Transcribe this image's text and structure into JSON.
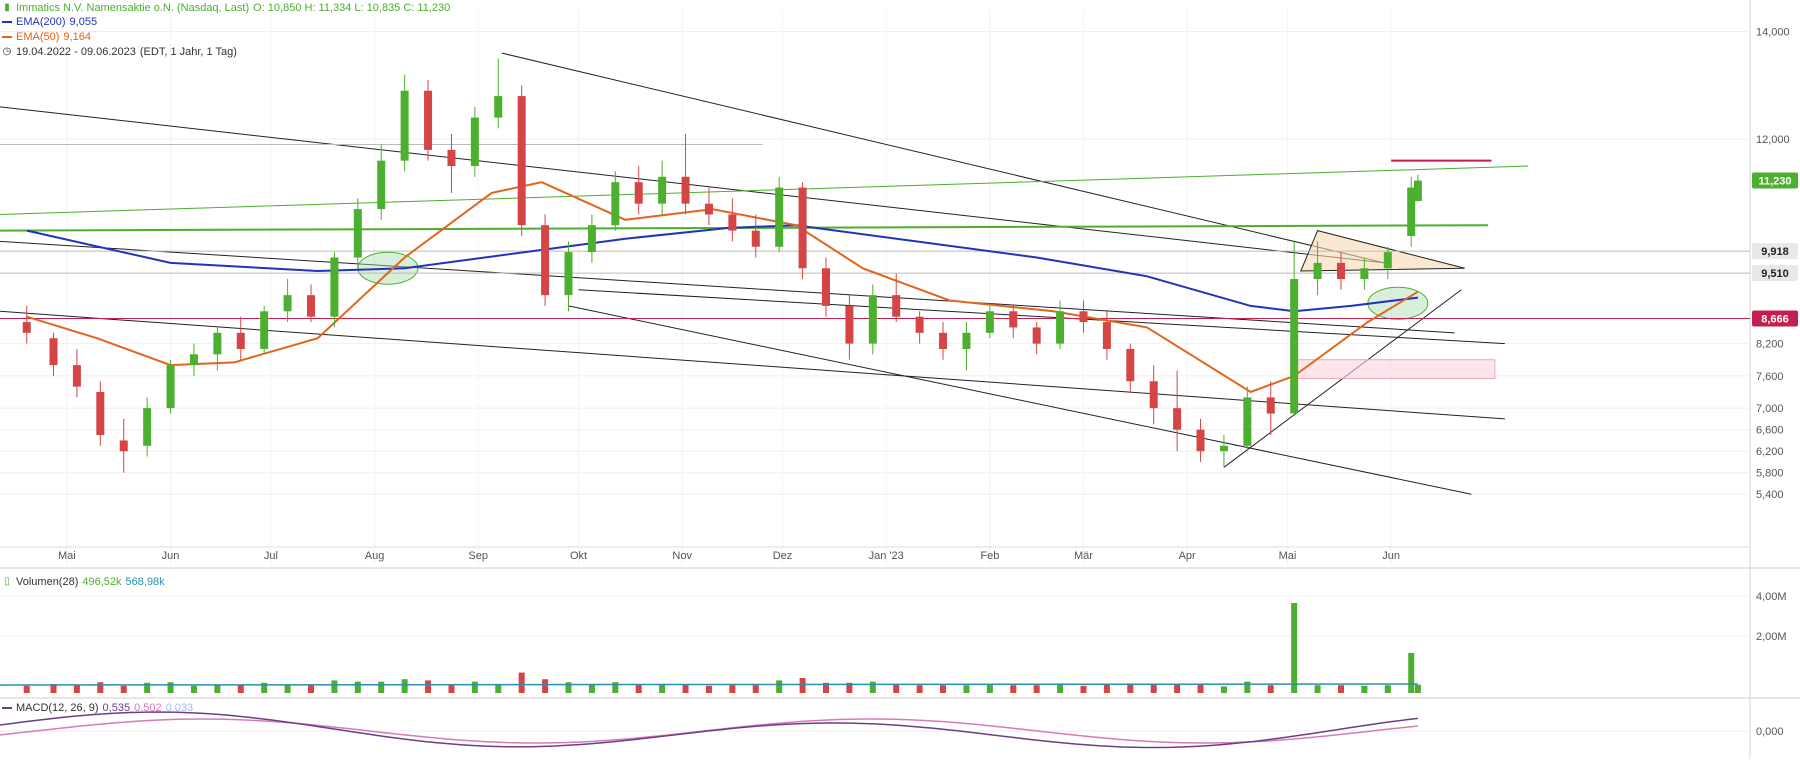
{
  "header": {
    "title": "Immatics N.V. Namensaktie  o.N. (Nasdaq, Last)",
    "ohlc": "O: 10,850  H: 11,334  L: 10,835  C: 11,230",
    "ema200_label": "EMA(200)",
    "ema200_value": "9,055",
    "ema50_label": "EMA(50)",
    "ema50_value": "9,164",
    "range": "19.04.2022 - 09.06.2023",
    "interval": "(EDT, 1 Jahr, 1 Tag)"
  },
  "volume_panel": {
    "label": "Volumen(28)",
    "v1": "496,52k",
    "v2": "568,98k",
    "ticks": [
      "4,00M",
      "2,00M"
    ]
  },
  "macd_panel": {
    "label": "MACD(12, 26, 9)",
    "v1": "0,535",
    "v2": "0,502",
    "v3": "0,033",
    "tick": "0,000"
  },
  "colors": {
    "up": "#4caf2f",
    "down": "#d64545",
    "ema200": "#2233bb",
    "ema50": "#e0661d",
    "macd": "#6a3f86",
    "signal": "#d77bb5",
    "histogram": "#9fc1e6",
    "resistance": "#c21f4f"
  },
  "chart_data": {
    "type": "candlestick",
    "x_range": [
      "2022-04-19",
      "2023-06-09"
    ],
    "x_ticks": [
      "Mai",
      "Jun",
      "Jul",
      "Aug",
      "Sep",
      "Okt",
      "Nov",
      "Dez",
      "Jan '23",
      "Feb",
      "Mär",
      "Apr",
      "Mai",
      "Jun"
    ],
    "y_ticks": [
      "14,000",
      "12,000",
      "11,230",
      "9,918",
      "9,510",
      "8,666",
      "8,200",
      "7,600",
      "7,000",
      "6,600",
      "6,200",
      "5,800",
      "5,400"
    ],
    "ylim": [
      5.2,
      14.4
    ],
    "price_labels": [
      {
        "value": "11,230",
        "type": "last"
      },
      {
        "value": "9,918",
        "type": "level"
      },
      {
        "value": "9,510",
        "type": "level"
      },
      {
        "value": "8,666",
        "type": "level"
      }
    ],
    "series": [
      {
        "name": "Immatics N.V. Namensaktie o.N.",
        "type": "ohlc",
        "data": [
          [
            "2022-04-19",
            8.6,
            8.9,
            8.2,
            8.4
          ],
          [
            "2022-04-27",
            8.3,
            8.4,
            7.6,
            7.8
          ],
          [
            "2022-05-04",
            7.8,
            8.1,
            7.2,
            7.4
          ],
          [
            "2022-05-11",
            7.3,
            7.5,
            6.3,
            6.5
          ],
          [
            "2022-05-18",
            6.4,
            6.8,
            5.8,
            6.2
          ],
          [
            "2022-05-25",
            6.3,
            7.2,
            6.1,
            7.0
          ],
          [
            "2022-06-01",
            7.0,
            7.9,
            6.9,
            7.8
          ],
          [
            "2022-06-08",
            7.8,
            8.2,
            7.6,
            8.0
          ],
          [
            "2022-06-15",
            8.0,
            8.5,
            7.7,
            8.4
          ],
          [
            "2022-06-22",
            8.4,
            8.7,
            7.9,
            8.1
          ],
          [
            "2022-06-29",
            8.1,
            8.9,
            8.0,
            8.8
          ],
          [
            "2022-07-06",
            8.8,
            9.4,
            8.6,
            9.1
          ],
          [
            "2022-07-13",
            9.1,
            9.3,
            8.6,
            8.7
          ],
          [
            "2022-07-20",
            8.7,
            9.9,
            8.5,
            9.8
          ],
          [
            "2022-07-27",
            9.8,
            10.9,
            9.6,
            10.7
          ],
          [
            "2022-08-03",
            10.7,
            11.9,
            10.5,
            11.6
          ],
          [
            "2022-08-10",
            11.6,
            13.2,
            11.4,
            12.9
          ],
          [
            "2022-08-17",
            12.9,
            13.1,
            11.6,
            11.8
          ],
          [
            "2022-08-24",
            11.8,
            12.1,
            11.0,
            11.5
          ],
          [
            "2022-08-31",
            11.5,
            12.6,
            11.3,
            12.4
          ],
          [
            "2022-09-07",
            12.4,
            13.5,
            12.2,
            12.8
          ],
          [
            "2022-09-14",
            12.8,
            13.0,
            10.2,
            10.4
          ],
          [
            "2022-09-21",
            10.4,
            10.6,
            8.9,
            9.1
          ],
          [
            "2022-09-28",
            9.1,
            10.1,
            8.8,
            9.9
          ],
          [
            "2022-10-05",
            9.9,
            10.6,
            9.7,
            10.4
          ],
          [
            "2022-10-12",
            10.4,
            11.4,
            10.3,
            11.2
          ],
          [
            "2022-10-19",
            11.2,
            11.5,
            10.6,
            10.8
          ],
          [
            "2022-10-26",
            10.8,
            11.6,
            10.6,
            11.3
          ],
          [
            "2022-11-02",
            11.3,
            12.1,
            10.6,
            10.8
          ],
          [
            "2022-11-09",
            10.8,
            11.1,
            10.4,
            10.6
          ],
          [
            "2022-11-16",
            10.6,
            10.9,
            10.1,
            10.3
          ],
          [
            "2022-11-23",
            10.3,
            10.6,
            9.8,
            10.0
          ],
          [
            "2022-11-30",
            10.0,
            11.3,
            9.9,
            11.1
          ],
          [
            "2022-12-07",
            11.1,
            11.2,
            9.4,
            9.6
          ],
          [
            "2022-12-14",
            9.6,
            9.8,
            8.7,
            8.9
          ],
          [
            "2022-12-21",
            8.9,
            9.1,
            7.9,
            8.2
          ],
          [
            "2022-12-28",
            8.2,
            9.3,
            8.0,
            9.1
          ],
          [
            "2023-01-04",
            9.1,
            9.5,
            8.6,
            8.7
          ],
          [
            "2023-01-11",
            8.7,
            8.8,
            8.2,
            8.4
          ],
          [
            "2023-01-18",
            8.4,
            8.6,
            7.9,
            8.1
          ],
          [
            "2023-01-25",
            8.1,
            8.6,
            7.7,
            8.4
          ],
          [
            "2023-02-01",
            8.4,
            8.9,
            8.3,
            8.8
          ],
          [
            "2023-02-08",
            8.8,
            8.9,
            8.3,
            8.5
          ],
          [
            "2023-02-15",
            8.5,
            8.6,
            8.0,
            8.2
          ],
          [
            "2023-02-22",
            8.2,
            9.0,
            8.1,
            8.8
          ],
          [
            "2023-03-01",
            8.8,
            9.0,
            8.4,
            8.6
          ],
          [
            "2023-03-08",
            8.6,
            8.8,
            7.9,
            8.1
          ],
          [
            "2023-03-15",
            8.1,
            8.2,
            7.3,
            7.5
          ],
          [
            "2023-03-22",
            7.5,
            7.8,
            6.7,
            7.0
          ],
          [
            "2023-03-29",
            7.0,
            7.7,
            6.2,
            6.6
          ],
          [
            "2023-04-05",
            6.6,
            6.8,
            6.0,
            6.2
          ],
          [
            "2023-04-12",
            6.2,
            6.5,
            5.9,
            6.3
          ],
          [
            "2023-04-19",
            6.3,
            7.4,
            6.2,
            7.2
          ],
          [
            "2023-04-26",
            7.2,
            7.5,
            6.5,
            6.9
          ],
          [
            "2023-05-03",
            6.9,
            10.1,
            7.7,
            9.4
          ],
          [
            "2023-05-10",
            9.4,
            10.1,
            9.1,
            9.7
          ],
          [
            "2023-05-17",
            9.7,
            9.9,
            9.2,
            9.4
          ],
          [
            "2023-05-24",
            9.4,
            9.8,
            9.2,
            9.6
          ],
          [
            "2023-05-31",
            9.6,
            10.0,
            9.4,
            9.9
          ],
          [
            "2023-06-07",
            10.2,
            11.3,
            10.0,
            11.1
          ],
          [
            "2023-06-09",
            10.85,
            11.334,
            10.835,
            11.23
          ]
        ]
      },
      {
        "name": "EMA(200)",
        "type": "line",
        "data": [
          [
            "2022-04-19",
            10.3
          ],
          [
            "2022-06-01",
            9.7
          ],
          [
            "2022-07-15",
            9.55
          ],
          [
            "2022-08-10",
            9.6
          ],
          [
            "2022-09-15",
            9.9
          ],
          [
            "2022-10-15",
            10.15
          ],
          [
            "2022-11-15",
            10.35
          ],
          [
            "2022-12-05",
            10.4
          ],
          [
            "2023-01-10",
            10.1
          ],
          [
            "2023-02-15",
            9.8
          ],
          [
            "2023-03-20",
            9.45
          ],
          [
            "2023-04-20",
            8.9
          ],
          [
            "2023-05-03",
            8.8
          ],
          [
            "2023-05-20",
            8.9
          ],
          [
            "2023-06-09",
            9.055
          ]
        ]
      },
      {
        "name": "EMA(50)",
        "type": "line",
        "data": [
          [
            "2022-04-19",
            8.7
          ],
          [
            "2022-05-10",
            8.3
          ],
          [
            "2022-06-01",
            7.8
          ],
          [
            "2022-06-20",
            7.85
          ],
          [
            "2022-07-15",
            8.3
          ],
          [
            "2022-08-10",
            9.8
          ],
          [
            "2022-09-05",
            11.0
          ],
          [
            "2022-09-20",
            11.2
          ],
          [
            "2022-10-15",
            10.5
          ],
          [
            "2022-11-10",
            10.7
          ],
          [
            "2022-12-05",
            10.4
          ],
          [
            "2022-12-25",
            9.6
          ],
          [
            "2023-01-20",
            9.0
          ],
          [
            "2023-02-20",
            8.8
          ],
          [
            "2023-03-20",
            8.5
          ],
          [
            "2023-04-20",
            7.3
          ],
          [
            "2023-05-03",
            7.6
          ],
          [
            "2023-05-25",
            8.6
          ],
          [
            "2023-06-09",
            9.164
          ]
        ]
      }
    ]
  }
}
